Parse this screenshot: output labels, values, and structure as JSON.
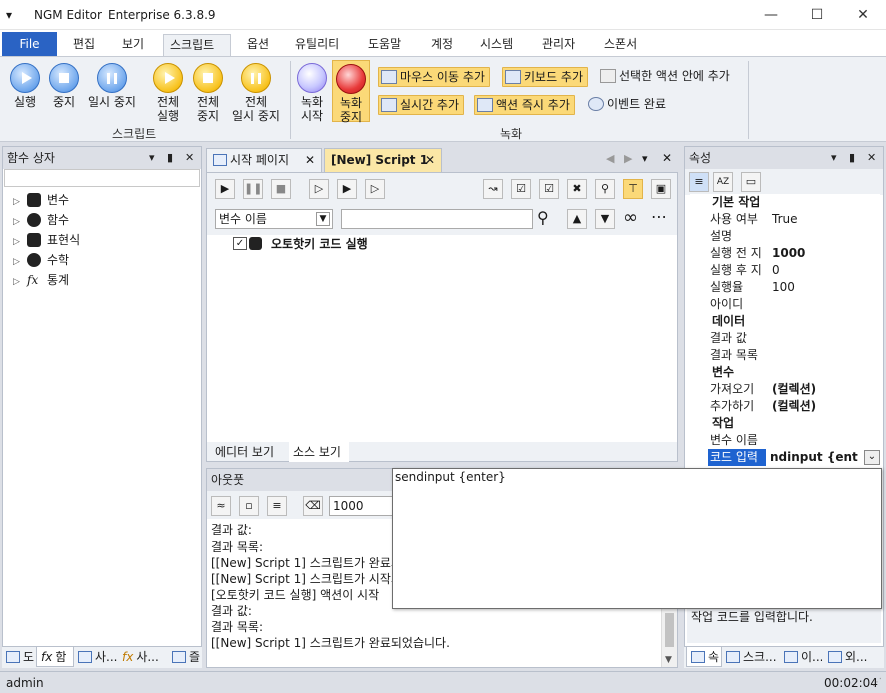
{
  "app": {
    "name": "NGM Editor",
    "edition": "Enterprise 6.3.8.9"
  },
  "ribbon_tabs": [
    "File",
    "편집",
    "보기",
    "스크립트",
    "옵션",
    "유틸리티",
    "도움말",
    "계정",
    "시스템",
    "관리자",
    "스폰서"
  ],
  "ribbon": {
    "run": "실행",
    "stop": "중지",
    "pause": "일시 중지",
    "run_all_1": "전체",
    "run_all_2": "실행",
    "stop_all_1": "전체",
    "stop_all_2": "중지",
    "pause_all_1": "전체",
    "pause_all_2": "일시 중지",
    "rec_start_1": "녹화",
    "rec_start_2": "시작",
    "rec_stop_1": "녹화",
    "rec_stop_2": "중지",
    "add_mouse": "마우스 이동 추가",
    "add_keyboard": "키보드 추가",
    "add_in_selected": "선택한 액션 안에 추가",
    "add_realtime": "실시간 추가",
    "add_action_now": "액션 즉시 추가",
    "event_done": "이벤트 완료",
    "group_script": "스크립트",
    "group_record": "녹화"
  },
  "left_panel": {
    "title": "함수 상자",
    "items": [
      "변수",
      "함수",
      "표현식",
      "수학",
      "통계"
    ],
    "bottom_tabs": [
      "도",
      "함",
      "사...",
      "사...",
      "즐"
    ]
  },
  "doc_tabs": [
    "시작 페이지",
    "[New] Script 1"
  ],
  "editor": {
    "var_select": "변수 이름",
    "action_label": "오토핫키 코드 실행",
    "view_tabs": [
      "에디터 보기",
      "소스 보기"
    ]
  },
  "output": {
    "title": "아웃풋",
    "count": "1000",
    "lines": [
      "결과 값:",
      "결과 목록:",
      "[[New] Script 1] 스크립트가 완료되",
      "[[New] Script 1] 스크립트가 시작되",
      "[오토핫키 코드 실행] 액션이 시작",
      "결과 값:",
      "결과 목록:",
      "[[New] Script 1] 스크립트가 완료되었습니다."
    ]
  },
  "props": {
    "title": "속성",
    "sections": [
      {
        "name": "기본 작업",
        "rows": [
          [
            "사용 여부",
            "True"
          ],
          [
            "설명",
            ""
          ],
          [
            "실행 전 지",
            "1000"
          ],
          [
            "실행 후 지",
            "0"
          ],
          [
            "실행율",
            "100"
          ],
          [
            "아이디",
            ""
          ]
        ]
      },
      {
        "name": "데이터",
        "rows": [
          [
            "결과 값",
            ""
          ],
          [
            "결과 목록",
            ""
          ]
        ]
      },
      {
        "name": "변수",
        "rows": [
          [
            "가져오기",
            "(컬렉션)"
          ],
          [
            "추가하기",
            "(컬렉션)"
          ]
        ]
      },
      {
        "name": "작업",
        "rows": [
          [
            "변수 이름",
            ""
          ],
          [
            "코드 입력",
            "ndinput {enter}"
          ]
        ]
      }
    ],
    "description": "작업 코드를 입력합니다.",
    "bottom_tabs": [
      "속",
      "스크...",
      "이...",
      "외..."
    ]
  },
  "popup": {
    "text": "sendinput {enter}"
  },
  "status": {
    "user": "admin",
    "time": "00:02:04"
  }
}
